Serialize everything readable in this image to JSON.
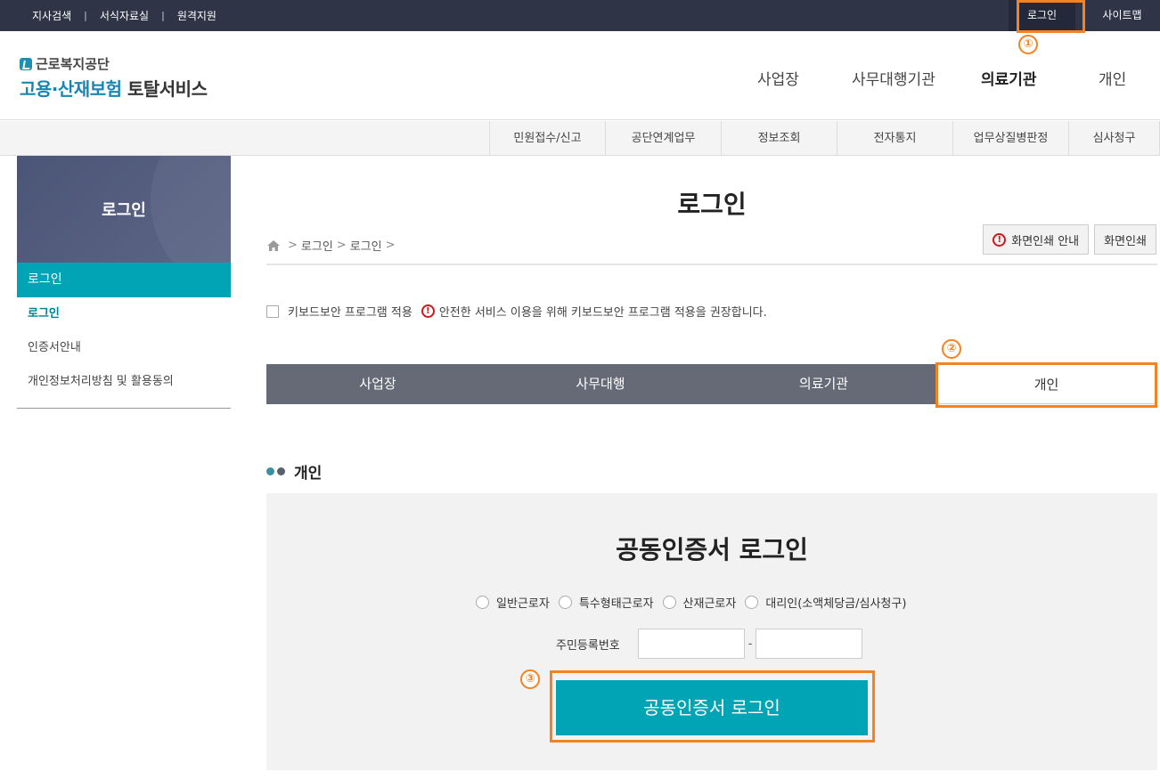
{
  "topbar": {
    "util": [
      "지사검색",
      "서식자료실",
      "원격지원"
    ],
    "separator": "|",
    "login": "로그인",
    "sitemap": "사이트맵"
  },
  "header": {
    "org": "근로복지공단",
    "service_accent": "고용·산재보험",
    "service_rest": "토탈서비스",
    "gnb": [
      "사업장",
      "사무대행기관",
      "의료기관",
      "개인"
    ],
    "gnb_active": "의료기관"
  },
  "subnav": [
    "민원접수/신고",
    "공단연계업무",
    "정보조회",
    "전자통지",
    "업무상질병판정",
    "심사청구"
  ],
  "sidebar": {
    "banner": "로그인",
    "current": "로그인",
    "items": [
      "로그인",
      "인증서안내",
      "개인정보처리방침 및 활용동의"
    ]
  },
  "main": {
    "title": "로그인",
    "breadcrumb": [
      "로그인",
      "로그인"
    ],
    "print_guide": "화면인쇄 안내",
    "print": "화면인쇄",
    "keyboard_label": "키보드보안 프로그램 적용",
    "keyboard_notice": "안전한 서비스 이용을 위해 키보드보안 프로그램 적용을 권장합니다.",
    "tabs": [
      "사업장",
      "사무대행",
      "의료기관",
      "개인"
    ],
    "selected_tab": "개인",
    "section_title": "개인",
    "panel_title": "공동인증서 로그인",
    "radio_options": [
      "일반근로자",
      "특수형태근로자",
      "산재근로자",
      "대리인(소액체당금/심사청구)"
    ],
    "ssn_label": "주민등록번호",
    "ssn_dash": "-",
    "login_button": "공동인증서 로그인"
  },
  "annotations": [
    "①",
    "②",
    "③"
  ],
  "colors": {
    "topbar": "#2f3446",
    "accent_teal": "#00a4b4",
    "tab_gray": "#656a76",
    "highlight": "#f58220",
    "warn_red": "#d0161c"
  }
}
